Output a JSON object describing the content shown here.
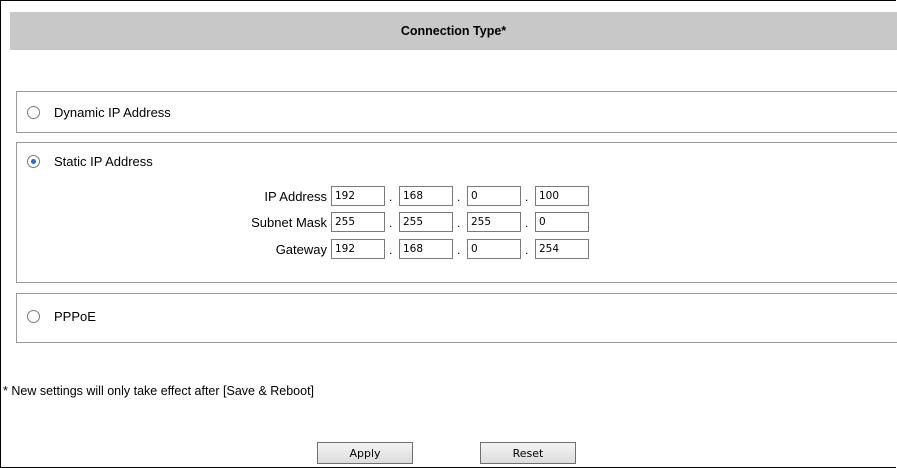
{
  "header": {
    "title": "Connection Type*"
  },
  "options": {
    "dynamic": {
      "label": "Dynamic IP Address",
      "selected": false
    },
    "static": {
      "label": "Static IP Address",
      "selected": true
    },
    "pppoe": {
      "label": "PPPoE",
      "selected": false
    }
  },
  "static_fields": {
    "ip_address": {
      "label": "IP Address",
      "octets": [
        "192",
        "168",
        "0",
        "100"
      ]
    },
    "subnet_mask": {
      "label": "Subnet Mask",
      "octets": [
        "255",
        "255",
        "255",
        "0"
      ]
    },
    "gateway": {
      "label": "Gateway",
      "octets": [
        "192",
        "168",
        "0",
        "254"
      ]
    },
    "separator": "."
  },
  "note": "* New settings will only take effect after [Save & Reboot]",
  "buttons": {
    "apply": "Apply",
    "reset": "Reset"
  },
  "colors": {
    "header_background": "#c8c8c8",
    "radio_selected": "#1a73d6",
    "border": "#9a9a9a"
  }
}
